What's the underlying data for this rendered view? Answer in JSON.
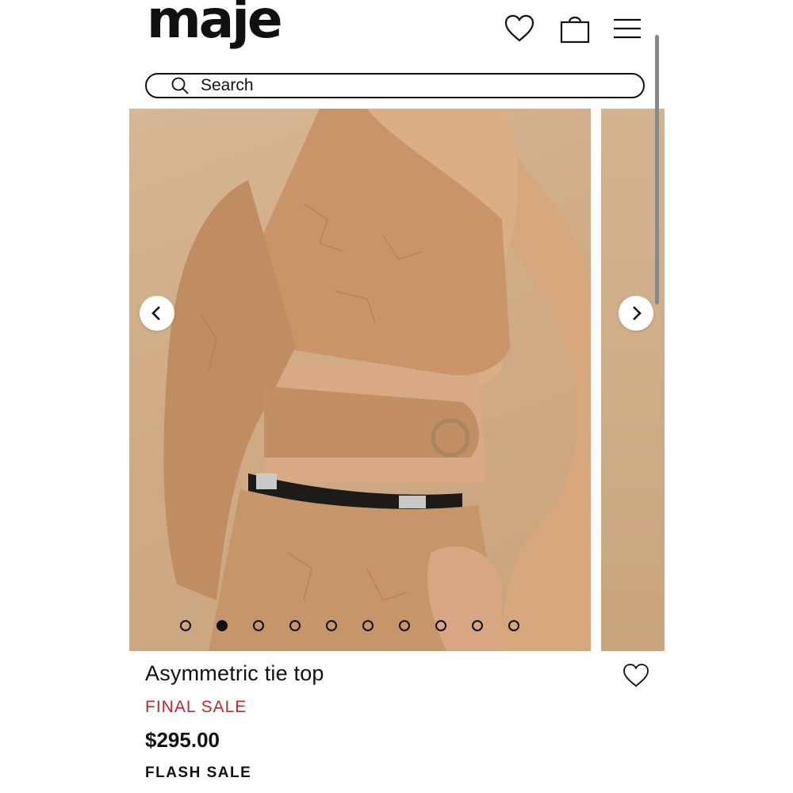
{
  "header": {
    "logo": "maje",
    "icons": {
      "wishlist": "heart-icon",
      "bag": "bag-icon",
      "menu": "menu-icon"
    }
  },
  "search": {
    "placeholder": "Search"
  },
  "gallery": {
    "image": "product-photo-tan-embroidered-top",
    "dots_total": 10,
    "active_index": 2
  },
  "product": {
    "title": "Asymmetric tie top",
    "badge": "FINAL SALE",
    "price": "$295.00",
    "promo": "FLASH SALE"
  },
  "colors": {
    "sale_red": "#c0282d",
    "photo_tan": "#cfac86"
  }
}
